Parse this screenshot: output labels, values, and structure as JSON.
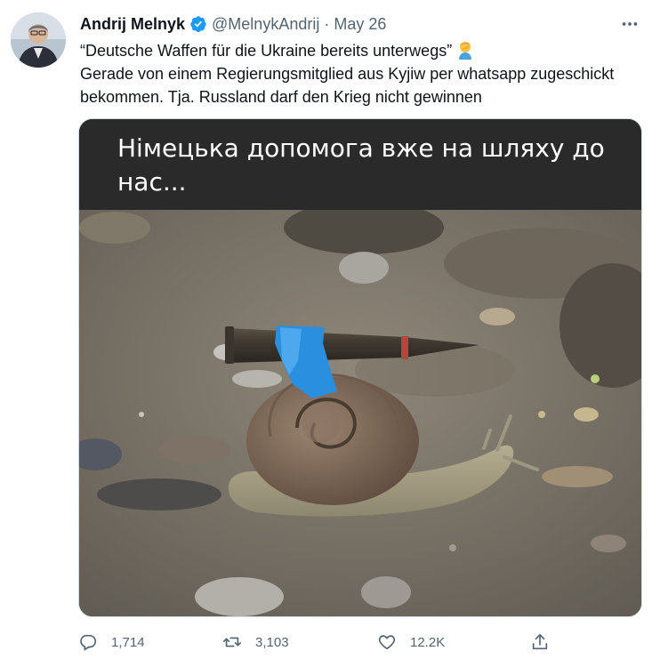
{
  "author": {
    "name": "Andrij Melnyk",
    "handle": "@MelnykAndrij",
    "date": "May 26"
  },
  "tweet": {
    "line1": "“Deutsche Waffen für die Ukraine bereits unterwegs”",
    "line2": "Gerade von einem Regierungsmitglied aus Kyjiw per whatsapp zugeschickt bekommen. Tja. Russland darf den Krieg nicht gewinnen"
  },
  "media": {
    "caption": "Німецька допомога вже на шляху до нас..."
  },
  "actions": {
    "replies": "1,714",
    "retweets": "3,103",
    "likes": "12.2K"
  },
  "colors": {
    "verified": "#1d9bf0",
    "muted": "#536471",
    "tape": "#2b8fe0"
  },
  "icons": {
    "reply": "reply-icon",
    "retweet": "retweet-icon",
    "like": "like-icon",
    "share": "share-icon",
    "more": "more-icon",
    "verified": "verified-badge-icon",
    "emoji": "person-facepalming-emoji"
  }
}
